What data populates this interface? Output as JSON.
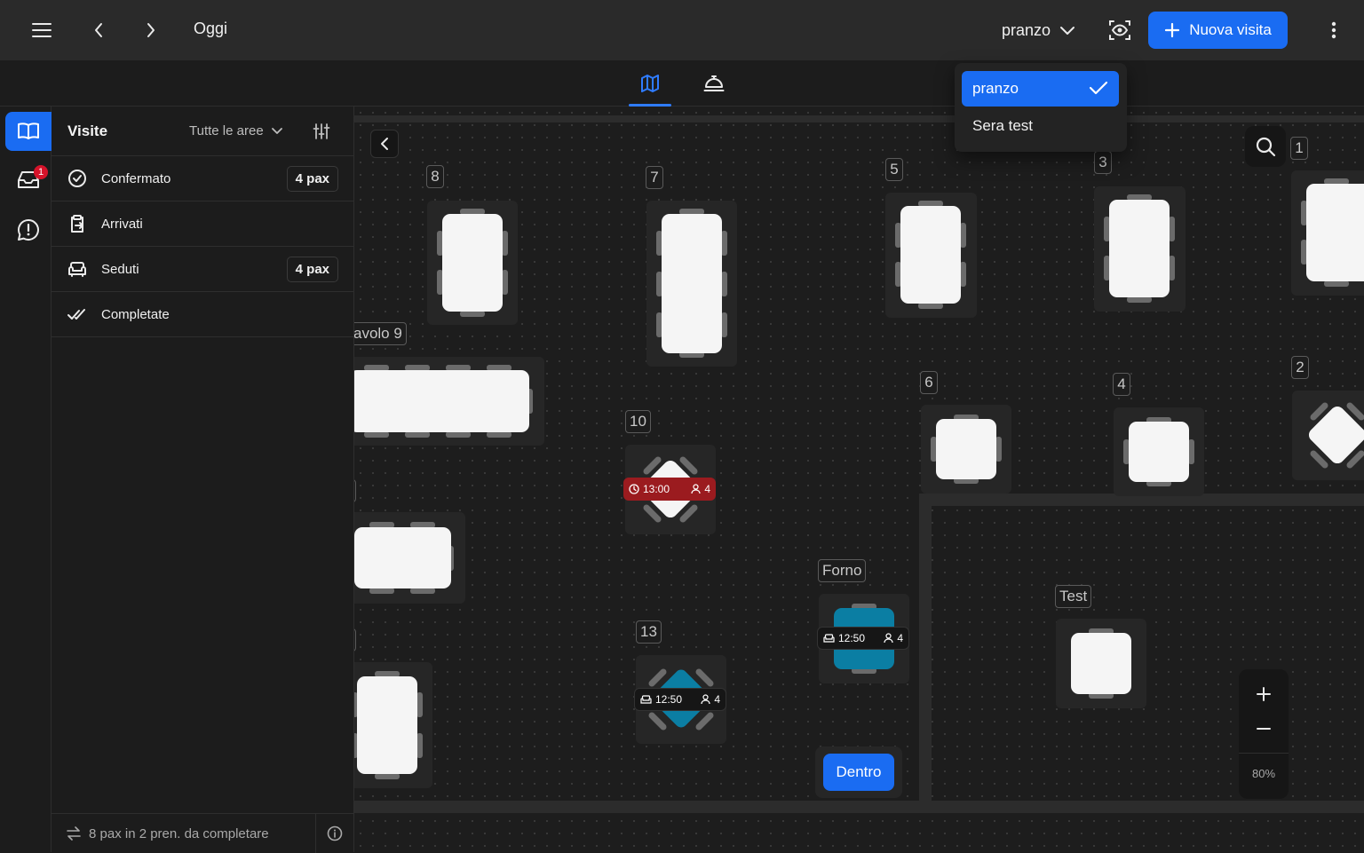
{
  "topbar": {
    "title": "Oggi",
    "service": "pranzo",
    "new_visit_label": "Nuova visita",
    "accent": "#1a6cf2"
  },
  "rail": {
    "inbox_badge": "1"
  },
  "panel": {
    "title": "Visite",
    "area_filter": "Tutte le aree",
    "rows": [
      {
        "label": "Confermato",
        "pax": "4 pax"
      },
      {
        "label": "Arrivati",
        "pax": ""
      },
      {
        "label": "Seduti",
        "pax": "4 pax"
      },
      {
        "label": "Completate",
        "pax": ""
      }
    ],
    "footer": "8 pax in 2 pren. da completare"
  },
  "dropdown": {
    "options": [
      {
        "label": "pranzo",
        "selected": true
      },
      {
        "label": "Sera test",
        "selected": false
      }
    ]
  },
  "map": {
    "labels": {
      "t8": "8",
      "t7": "7",
      "t5": "5",
      "t3": "3",
      "t1": "1",
      "t9": "avolo 9",
      "t10": "10",
      "t6": "6",
      "t4": "4",
      "t2": "2",
      "tedge1": "1",
      "tedge2": "2",
      "forno": "Forno",
      "t13": "13",
      "test": "Test"
    },
    "reservations": {
      "t10": {
        "time": "13:00",
        "guests": "4"
      },
      "forno": {
        "time": "12:50",
        "guests": "4"
      },
      "t13": {
        "time": "12:50",
        "guests": "4"
      }
    },
    "area_button": "Dentro",
    "zoom_level": "80%",
    "colors": {
      "seated": "#0b7ea3",
      "upcoming": "#9b1b1f",
      "free": "#f5f5f5"
    }
  }
}
